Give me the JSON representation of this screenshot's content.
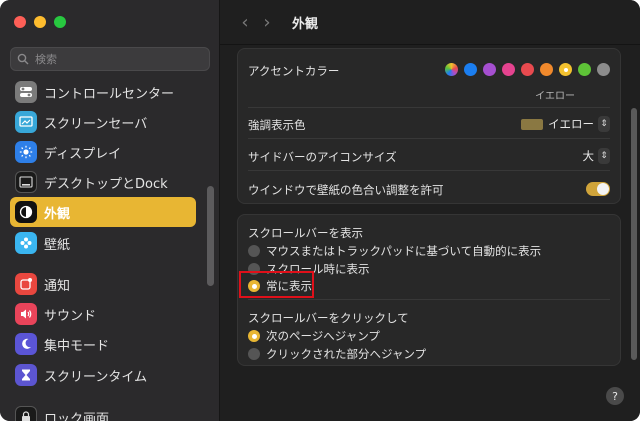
{
  "search": {
    "placeholder": "検索"
  },
  "sidebar": {
    "items": [
      {
        "label": "コントロールセンター",
        "icon": "control-center-icon",
        "color": "#7b7b7b"
      },
      {
        "label": "スクリーンセーバ",
        "icon": "screensaver-icon",
        "color": "#38a7d8"
      },
      {
        "label": "ディスプレイ",
        "icon": "display-brightness-icon",
        "color": "#2e7fe8"
      },
      {
        "label": "デスクトップとDock",
        "icon": "desktop-dock-icon",
        "color": "#1a1a1a"
      },
      {
        "label": "外観",
        "icon": "appearance-icon",
        "color": "#111111",
        "active": true
      },
      {
        "label": "壁紙",
        "icon": "wallpaper-icon",
        "color": "#3ab5f0"
      },
      {
        "label": "通知",
        "icon": "notifications-icon",
        "color": "#e9473f"
      },
      {
        "label": "サウンド",
        "icon": "sound-icon",
        "color": "#e9445a"
      },
      {
        "label": "集中モード",
        "icon": "focus-moon-icon",
        "color": "#5b55d6"
      },
      {
        "label": "スクリーンタイム",
        "icon": "screen-time-icon",
        "color": "#5c55d1"
      },
      {
        "label": "ロック画面",
        "icon": "lock-screen-icon",
        "color": "#1a1a1a"
      }
    ]
  },
  "header": {
    "title": "外観",
    "back": "‹",
    "forward": "›"
  },
  "accent": {
    "label": "アクセントカラー",
    "selected_name": "イエロー",
    "colors": [
      "multicolor",
      "#1b7ef0",
      "#a54fd0",
      "#e5438f",
      "#e84a4f",
      "#f0892c",
      "#f2c12f",
      "#5ec337",
      "#8c8c8c"
    ],
    "selected_index": 6
  },
  "highlight": {
    "label": "強調表示色",
    "value": "イエロー",
    "chip_color": "#8a7842"
  },
  "sidebar_icon_size": {
    "label": "サイドバーのアイコンサイズ",
    "value": "大"
  },
  "wallpaper_tint": {
    "label": "ウインドウで壁紙の色合い調整を許可",
    "enabled": true
  },
  "scrollbars": {
    "label": "スクロールバーを表示",
    "options": [
      {
        "label": "マウスまたはトラックパッドに基づいて自動的に表示",
        "selected": false
      },
      {
        "label": "スクロール時に表示",
        "selected": false
      },
      {
        "label": "常に表示",
        "selected": true
      }
    ]
  },
  "click_scroll": {
    "label": "スクロールバーをクリックして",
    "options": [
      {
        "label": "次のページへジャンプ",
        "selected": true
      },
      {
        "label": "クリックされた部分へジャンプ",
        "selected": false
      }
    ]
  },
  "help": {
    "label": "?"
  }
}
